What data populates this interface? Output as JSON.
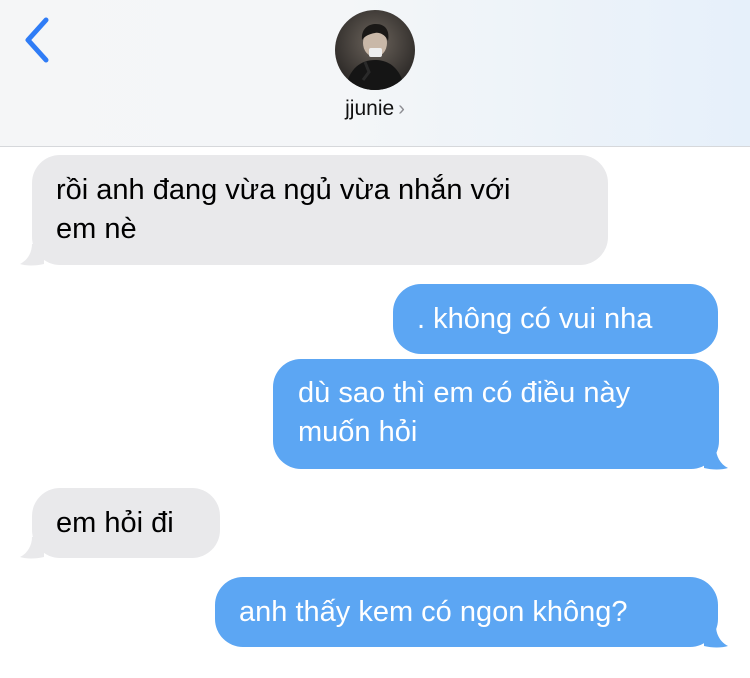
{
  "header": {
    "contact_name": "jjunie",
    "chevron": "›",
    "back_icon": "chevron-left-icon"
  },
  "colors": {
    "incoming_bubble": "#e9e9eb",
    "outgoing_bubble": "#5ca6f3",
    "accent": "#2f7cf6"
  },
  "messages": [
    {
      "direction": "incoming",
      "line1": "rồi anh đang vừa ngủ vừa nhắn với",
      "line2": "em nè"
    },
    {
      "direction": "outgoing",
      "line1": ". không có vui nha"
    },
    {
      "direction": "outgoing",
      "line1": "dù sao thì em có điều này",
      "line2": "muốn hỏi"
    },
    {
      "direction": "incoming",
      "line1": "em hỏi đi"
    },
    {
      "direction": "outgoing",
      "line1": "anh thấy kem có ngon không?"
    }
  ]
}
